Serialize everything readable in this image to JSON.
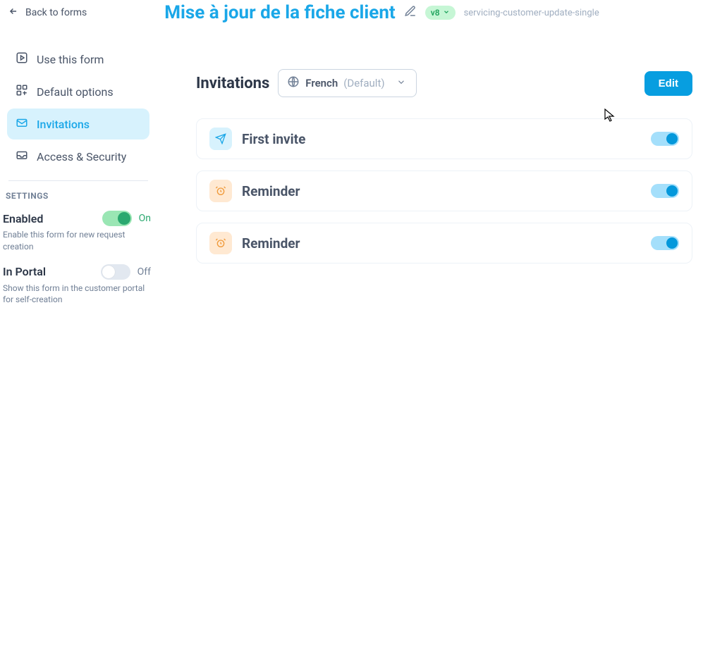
{
  "header": {
    "back_label": "Back to forms",
    "title": "Mise à jour de la fiche client",
    "version": "v8",
    "slug": "servicing-customer-update-single"
  },
  "sidebar": {
    "items": [
      {
        "label": "Use this form"
      },
      {
        "label": "Default options"
      },
      {
        "label": "Invitations"
      },
      {
        "label": "Access & Security"
      }
    ],
    "active_index": 2,
    "settings_header": "SETTINGS",
    "settings": [
      {
        "label": "Enabled",
        "on": true,
        "status": "On",
        "desc": "Enable this form for new request creation"
      },
      {
        "label": "In Portal",
        "on": false,
        "status": "Off",
        "desc": "Show this form in the customer portal for self-creation"
      }
    ]
  },
  "main": {
    "section_title": "Invitations",
    "language": {
      "name": "French",
      "default_suffix": "(Default)"
    },
    "edit_button": "Edit",
    "invitations": [
      {
        "type": "first",
        "title": "First invite",
        "enabled": true
      },
      {
        "type": "reminder",
        "title": "Reminder",
        "enabled": true
      },
      {
        "type": "reminder",
        "title": "Reminder",
        "enabled": true
      }
    ]
  }
}
